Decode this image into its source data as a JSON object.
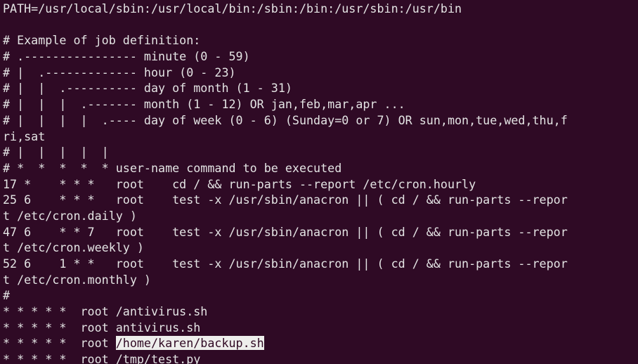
{
  "terminal": {
    "lines": [
      "PATH=/usr/local/sbin:/usr/local/bin:/sbin:/bin:/usr/sbin:/usr/bin",
      "",
      "# Example of job definition:",
      "# .---------------- minute (0 - 59)",
      "# |  .------------- hour (0 - 23)",
      "# |  |  .---------- day of month (1 - 31)",
      "# |  |  |  .------- month (1 - 12) OR jan,feb,mar,apr ...",
      "# |  |  |  |  .---- day of week (0 - 6) (Sunday=0 or 7) OR sun,mon,tue,wed,thu,f",
      "ri,sat",
      "# |  |  |  |  |",
      "# *  *  *  *  * user-name command to be executed",
      "17 *    * * *   root    cd / && run-parts --report /etc/cron.hourly",
      "25 6    * * *   root    test -x /usr/sbin/anacron || ( cd / && run-parts --repor",
      "t /etc/cron.daily )",
      "47 6    * * 7   root    test -x /usr/sbin/anacron || ( cd / && run-parts --repor",
      "t /etc/cron.weekly )",
      "52 6    1 * *   root    test -x /usr/sbin/anacron || ( cd / && run-parts --repor",
      "t /etc/cron.monthly )",
      "#",
      "* * * * *  root /antivirus.sh",
      "* * * * *  root antivirus.sh"
    ],
    "backup_line": {
      "prefix": "* * * * *  root ",
      "highlighted": "/home/karen/backup.sh"
    },
    "last_line": "* * * * *  root /tmp/test.py"
  }
}
